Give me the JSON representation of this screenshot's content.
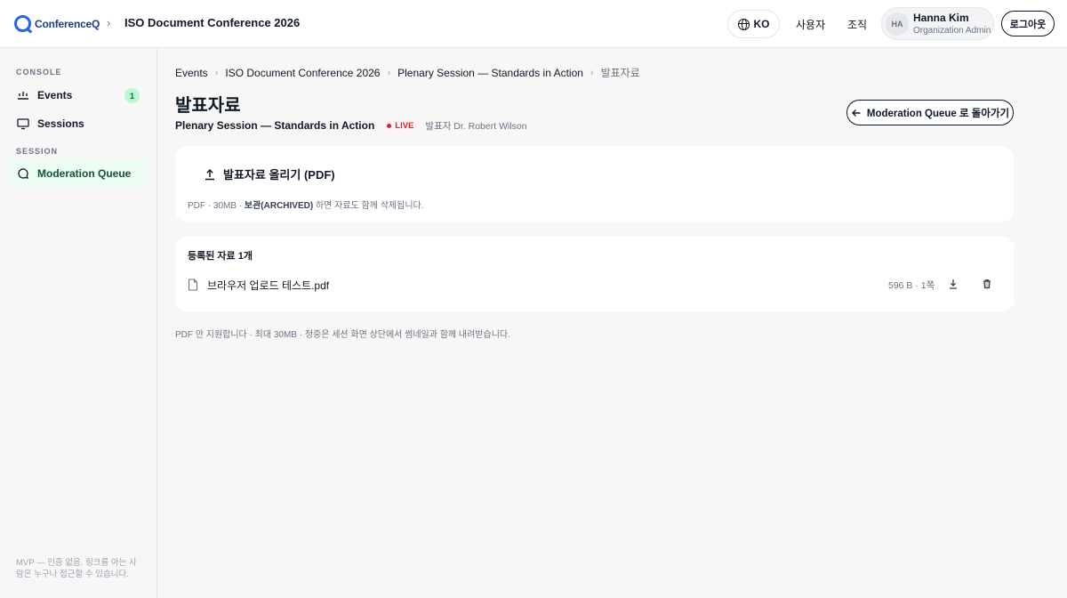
{
  "header": {
    "logo_text": "ConferenceQ",
    "event_title": "ISO Document Conference 2026",
    "language": "KO",
    "nav": [
      "사용자",
      "조직"
    ],
    "user": {
      "initials": "HA",
      "name": "Hanna Kim",
      "role": "Organization Admin"
    },
    "logout_label": "로그아웃"
  },
  "sidebar": {
    "section_console": "CONSOLE",
    "section_session": "SESSION",
    "items": [
      {
        "label": "Events",
        "badge": "1",
        "icon": "events-icon"
      },
      {
        "label": "Sessions",
        "icon": "monitor-icon"
      },
      {
        "label": "Moderation Queue",
        "icon": "chat-bubble-icon",
        "active": true
      }
    ],
    "footer": "MVP — 인증 없음. 링크를 아는 사람은 누구나 접근할 수 있습니다."
  },
  "breadcrumb": [
    "Events",
    "ISO Document Conference 2026",
    "Plenary Session — Standards in Action",
    "발표자료"
  ],
  "page": {
    "title": "발표자료",
    "session_name": "Plenary Session — Standards in Action",
    "live_label": "LIVE",
    "speaker": "발표자 Dr. Robert Wilson",
    "back_button": "Moderation Queue 로 돌아가기"
  },
  "upload": {
    "button_label": "발표자료 올리기 (PDF)",
    "hint_prefix": "PDF · 30MB · ",
    "hint_bold": "보관(ARCHIVED)",
    "hint_suffix": " 하면 자료도 함께 삭제됩니다."
  },
  "files": {
    "title": "등록된 자료 1개",
    "items": [
      {
        "name": "브라우저 업로드 테스트.pdf",
        "meta": "596 B · 1쪽"
      }
    ]
  },
  "footer_note": "PDF 만 지원합니다 · 최대 30MB · 청중은 세션 화면 상단에서 썸네일과 함께 내려받습니다.",
  "colors": {
    "accent": "#2563eb",
    "live": "#dc2626",
    "active_bg": "#ecfdf3",
    "badge_bg": "#bbf7d0"
  }
}
